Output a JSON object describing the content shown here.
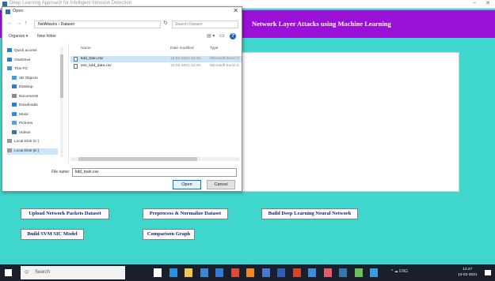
{
  "app": {
    "window_title": "Deep Learning Approach for Intelligent Intrusion Detection",
    "heading": "Network Layer Attacks using Machine Learning"
  },
  "buttons": {
    "upload": "Upload Network Packets Dataset",
    "preprocess": "Preprocess & Normalize Dataset",
    "build_dnn": "Build Deep Learning Neural Network",
    "build_svm": "Build SVM SIC Model",
    "compare": "Comparison Graph"
  },
  "dialog": {
    "title": "Open",
    "address": "NetAttacks  ›  Dataset",
    "search_placeholder": "Search Dataset",
    "toolbar": {
      "organize": "Organize ▾",
      "new_folder": "New folder"
    },
    "sidebar": [
      {
        "label": "Quick access",
        "icon": "star-icon",
        "color": "#2f7bd6"
      },
      {
        "label": "OneDrive",
        "icon": "cloud-icon",
        "color": "#2f7bd6"
      },
      {
        "label": "This PC",
        "icon": "computer-icon",
        "color": "#4a90d9"
      },
      {
        "label": "3D Objects",
        "icon": "cube-icon",
        "color": "#3aa0e0"
      },
      {
        "label": "Desktop",
        "icon": "desktop-icon",
        "color": "#2a7fd4"
      },
      {
        "label": "Documents",
        "icon": "documents-icon",
        "color": "#8a8a8a"
      },
      {
        "label": "Downloads",
        "icon": "download-icon",
        "color": "#2a7fd4"
      },
      {
        "label": "Music",
        "icon": "music-icon",
        "color": "#3a86d8"
      },
      {
        "label": "Pictures",
        "icon": "pictures-icon",
        "color": "#5aa0e0"
      },
      {
        "label": "Videos",
        "icon": "videos-icon",
        "color": "#3a6fb0"
      },
      {
        "label": "Local Disk (C:)",
        "icon": "disk-icon",
        "color": "#9a9a9a"
      },
      {
        "label": "Local Disk (E:)",
        "icon": "disk-icon",
        "color": "#9a9a9a"
      }
    ],
    "columns": {
      "name": "Name",
      "date": "Date modified",
      "type": "Type"
    },
    "files": [
      {
        "name": "kdd_train.csv",
        "date": "12-02-2021 12:48",
        "type": "Microsoft Excel C"
      },
      {
        "name": "test_kdd_data.csv",
        "date": "12-02-2021 12:49",
        "type": "Microsoft Excel C"
      }
    ],
    "filename_label": "File name:",
    "filename_value": "kdd_train.csv",
    "open": "Open",
    "cancel": "Cancel"
  },
  "taskbar": {
    "search_placeholder": "Search",
    "apps": [
      {
        "icon": "task-view-icon",
        "color": "#ffffff"
      },
      {
        "icon": "edge-icon",
        "color": "#2b8fe0"
      },
      {
        "icon": "file-explorer-icon",
        "color": "#f2c94c"
      },
      {
        "icon": "store-icon",
        "color": "#3a86d8"
      },
      {
        "icon": "mail-icon",
        "color": "#2f7bd6"
      },
      {
        "icon": "chrome-icon",
        "color": "#e0483b"
      },
      {
        "icon": "firefox-icon",
        "color": "#f08a24"
      },
      {
        "icon": "app-icon",
        "color": "#4a78d0"
      },
      {
        "icon": "word-icon",
        "color": "#2b5fb3"
      },
      {
        "icon": "powerpoint-icon",
        "color": "#d24726"
      },
      {
        "icon": "app-icon",
        "color": "#3c8dde"
      },
      {
        "icon": "photos-icon",
        "color": "#e35d6a"
      },
      {
        "icon": "python-icon",
        "color": "#3776ab"
      },
      {
        "icon": "app-icon",
        "color": "#6bbf59"
      },
      {
        "icon": "app-icon",
        "color": "#3b9ce0"
      }
    ],
    "tray_text": "^  ☁  ENG",
    "time": "14:27",
    "date": "13-02-2021"
  }
}
